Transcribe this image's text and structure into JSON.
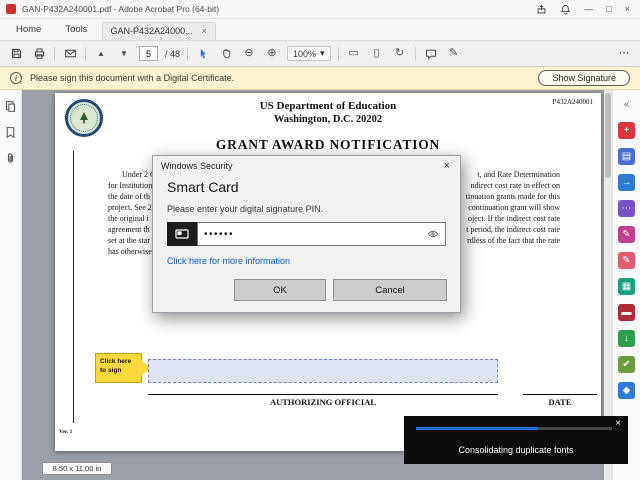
{
  "window": {
    "title": "GAN-P432A240001.pdf - Adobe Acrobat Pro (64-bit)",
    "controls": {
      "minimize": "—",
      "maximize": "□",
      "close": "×"
    }
  },
  "tabs": {
    "home": "Home",
    "tools": "Tools",
    "document": "GAN-P432A24000...",
    "close_glyph": "×"
  },
  "toolbar": {
    "page_current": "5",
    "page_total": "/ 48",
    "zoom": "100%"
  },
  "glyphs": {
    "close": "×",
    "caret_down": "▾",
    "info": "i",
    "page_up": "▲",
    "page_down": "▼",
    "zoom_out": "⊖",
    "zoom_in": "⊕",
    "fit_page": "▭",
    "fit_width": "▯",
    "rotate": "↻",
    "pen": "✎",
    "more": "⋯"
  },
  "sign_bar": {
    "message": "Please sign this document with a Digital Certificate.",
    "button": "Show Signature"
  },
  "document": {
    "doc_number": "P432A240001",
    "dept_line1": "US Department of Education",
    "dept_line2": "Washington, D.C. 20202",
    "title": "GRANT AWARD NOTIFICATION",
    "body_lines": [
      {
        "left": "Under 2 CFR",
        "right": "t, and Rate Determination"
      },
      {
        "left": "for Institution",
        "right": "ndirect cost rate in effect on"
      },
      {
        "left": "the date of th",
        "right": "tinuation grants made for this"
      },
      {
        "left": "project. See 2",
        "right": "continuation grant will show"
      },
      {
        "left": "the original i",
        "right": "oject. If the indirect cost rate"
      },
      {
        "left": "agreement th",
        "right": "t period, the indirect cost rate"
      },
      {
        "left": "set at the star",
        "right": "rdless of the fact that the rate"
      },
      {
        "left": "has otherwise",
        "right": ""
      }
    ],
    "sign_callout_line1": "Click here",
    "sign_callout_line2": "to sign",
    "authorizing_official": "AUTHORIZING OFFICIAL",
    "date_label": "DATE",
    "version": "Ver. 1"
  },
  "dialog": {
    "title": "Windows Security",
    "heading": "Smart Card",
    "prompt": "Please enter your digital signature PIN.",
    "pin_value": "••••••",
    "link": "Click here for more information",
    "ok_label": "OK",
    "cancel_label": "Cancel"
  },
  "toast": {
    "message": "Consolidating duplicate fonts",
    "progress_percent": 62
  },
  "status": {
    "page_size": "8.50 x 11.00 in"
  },
  "right_rail": {
    "tools": [
      {
        "name": "collapse-panel-icon",
        "glyph": "«",
        "bg": "transparent",
        "fg": "#5f6368"
      },
      {
        "name": "create-pdf-icon",
        "glyph": "+",
        "bg": "#d9363e",
        "fg": "#ffffff"
      },
      {
        "name": "combine-files-icon",
        "glyph": "▤",
        "bg": "#4a6fd4",
        "fg": "#ffffff"
      },
      {
        "name": "export-pdf-icon",
        "glyph": "→",
        "bg": "#2d7dd2",
        "fg": "#ffffff"
      },
      {
        "name": "comment-icon",
        "glyph": "⋯",
        "bg": "#7a52c7",
        "fg": "#ffffff"
      },
      {
        "name": "fill-sign-icon",
        "glyph": "✎",
        "bg": "#c2408e",
        "fg": "#ffffff"
      },
      {
        "name": "edit-pdf-icon",
        "glyph": "✎",
        "bg": "#e05c6e",
        "fg": "#ffffff"
      },
      {
        "name": "organize-pages-icon",
        "glyph": "▦",
        "bg": "#18a07f",
        "fg": "#ffffff"
      },
      {
        "name": "redact-icon",
        "glyph": "▬",
        "bg": "#b02a37",
        "fg": "#ffffff"
      },
      {
        "name": "compress-pdf-icon",
        "glyph": "↓",
        "bg": "#2e9e4f",
        "fg": "#ffffff"
      },
      {
        "name": "prepare-form-icon",
        "glyph": "✔",
        "bg": "#6c9a3f",
        "fg": "#ffffff"
      },
      {
        "name": "protect-icon",
        "glyph": "◆",
        "bg": "#2d7dd2",
        "fg": "#ffffff"
      }
    ]
  },
  "icons": {
    "titlebar": [
      "share-icon",
      "notifications-icon"
    ],
    "toolbar": [
      "save-icon",
      "print-icon",
      "email-icon",
      "select-tool-icon",
      "hand-tool-icon",
      "comment-tool-icon"
    ],
    "left_rail": [
      "page-thumbnails-icon",
      "bookmarks-icon",
      "attachments-icon"
    ],
    "dialog": [
      "smart-card-icon",
      "eye-icon"
    ],
    "document": [
      "education-seal"
    ]
  }
}
